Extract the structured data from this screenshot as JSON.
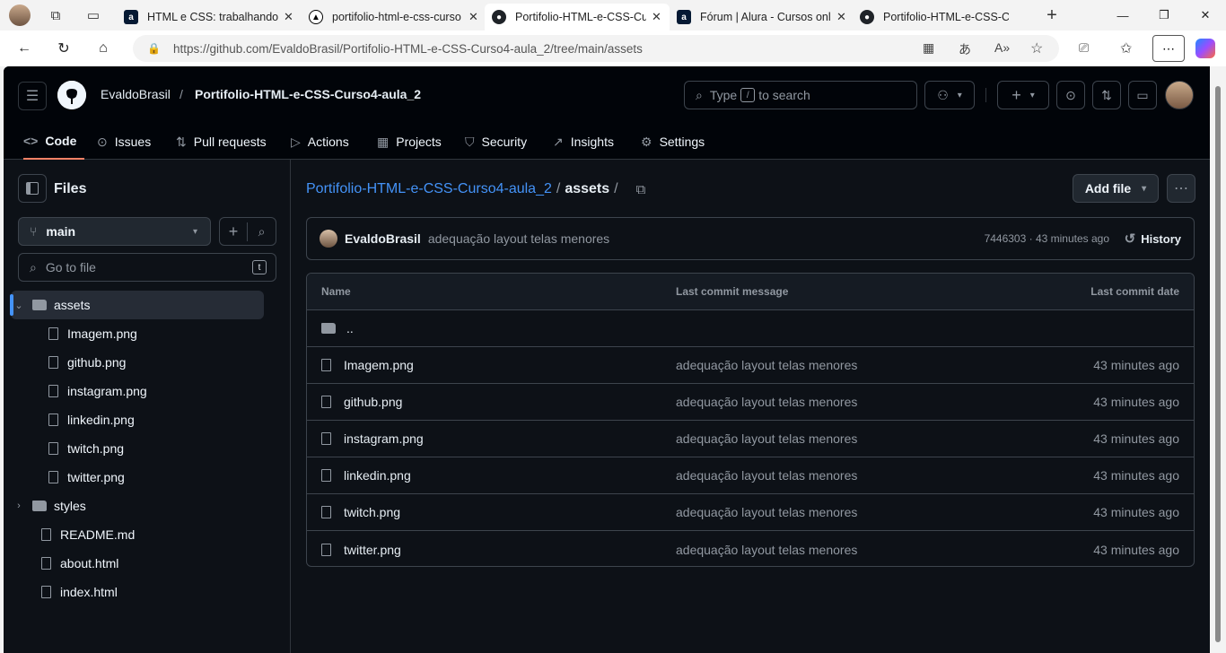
{
  "browser": {
    "tabs": [
      {
        "title": "HTML e CSS: trabalhando c",
        "icon": "alura-icon",
        "active": false
      },
      {
        "title": "portifolio-html-e-css-curso",
        "icon": "vercel-icon",
        "active": false
      },
      {
        "title": "Portifolio-HTML-e-CSS-Cur",
        "icon": "github-icon",
        "active": true
      },
      {
        "title": "Fórum | Alura - Cursos onli",
        "icon": "alura-icon",
        "active": false
      },
      {
        "title": "Portifolio-HTML-e-CSS-Cur",
        "icon": "github-icon",
        "active": false
      }
    ],
    "url": "https://github.com/EvaldoBrasil/Portifolio-HTML-e-CSS-Curso4-aula_2/tree/main/assets"
  },
  "header": {
    "owner": "EvaldoBrasil",
    "separator": "/",
    "repo": "Portifolio-HTML-e-CSS-Curso4-aula_2",
    "search_prefix": "Type",
    "search_key": "/",
    "search_suffix": "to search",
    "nav": [
      {
        "label": "Code",
        "icon": "code-icon"
      },
      {
        "label": "Issues",
        "icon": "issue-icon"
      },
      {
        "label": "Pull requests",
        "icon": "pull-request-icon"
      },
      {
        "label": "Actions",
        "icon": "play-icon"
      },
      {
        "label": "Projects",
        "icon": "table-icon"
      },
      {
        "label": "Security",
        "icon": "shield-icon"
      },
      {
        "label": "Insights",
        "icon": "graph-icon"
      },
      {
        "label": "Settings",
        "icon": "gear-icon"
      }
    ]
  },
  "sidebar": {
    "title": "Files",
    "branch": "main",
    "goto_placeholder": "Go to file",
    "goto_key": "t",
    "tree": [
      {
        "label": "assets",
        "type": "folder",
        "expanded": true,
        "selected": true
      },
      {
        "label": "Imagem.png",
        "type": "file"
      },
      {
        "label": "github.png",
        "type": "file"
      },
      {
        "label": "instagram.png",
        "type": "file"
      },
      {
        "label": "linkedin.png",
        "type": "file"
      },
      {
        "label": "twitch.png",
        "type": "file"
      },
      {
        "label": "twitter.png",
        "type": "file"
      },
      {
        "label": "styles",
        "type": "folder",
        "expanded": false
      },
      {
        "label": "README.md",
        "type": "file"
      },
      {
        "label": "about.html",
        "type": "file"
      },
      {
        "label": "index.html",
        "type": "file"
      }
    ]
  },
  "main": {
    "breadcrumb_repo": "Portifolio-HTML-e-CSS-Curso4-aula_2",
    "breadcrumb_sep": "/",
    "breadcrumb_dir": "assets",
    "breadcrumb_trail": "/",
    "add_file_label": "Add file",
    "commit": {
      "author": "EvaldoBrasil",
      "message": "adequação layout telas menores",
      "meta": "7446303 · 43 minutes ago",
      "history_label": "History"
    },
    "table": {
      "headers": {
        "name": "Name",
        "message": "Last commit message",
        "date": "Last commit date"
      },
      "parent": "..",
      "rows": [
        {
          "name": "Imagem.png",
          "message": "adequação layout telas menores",
          "date": "43 minutes ago"
        },
        {
          "name": "github.png",
          "message": "adequação layout telas menores",
          "date": "43 minutes ago"
        },
        {
          "name": "instagram.png",
          "message": "adequação layout telas menores",
          "date": "43 minutes ago"
        },
        {
          "name": "linkedin.png",
          "message": "adequação layout telas menores",
          "date": "43 minutes ago"
        },
        {
          "name": "twitch.png",
          "message": "adequação layout telas menores",
          "date": "43 minutes ago"
        },
        {
          "name": "twitter.png",
          "message": "adequação layout telas menores",
          "date": "43 minutes ago"
        }
      ]
    }
  },
  "colors": {
    "link": "#4493f8",
    "accent_underline": "#f78166",
    "background": "#0d1117"
  }
}
